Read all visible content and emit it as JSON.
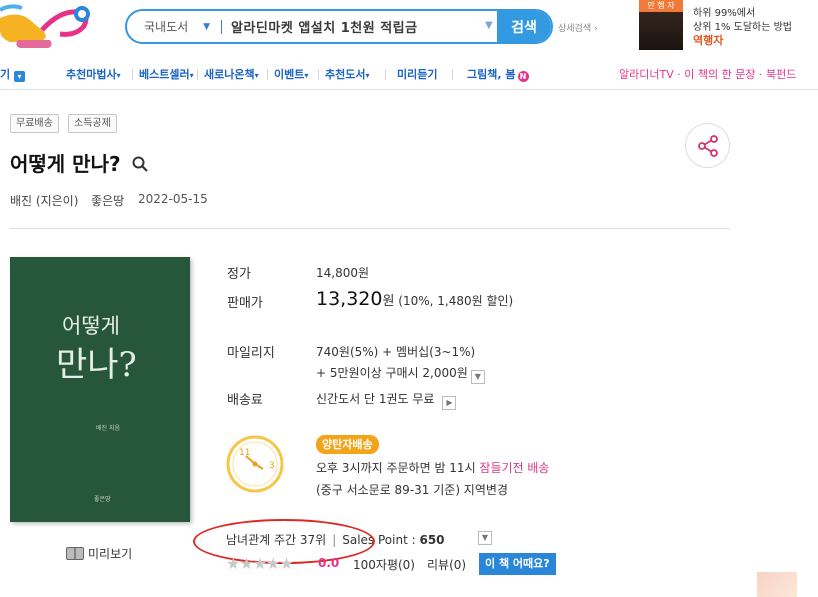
{
  "header": {
    "search": {
      "category": "국내도서",
      "query": "알라딘마켓 앱설치 1천원 적립금",
      "button": "검색",
      "detail_link": "상세검색"
    },
    "ad": {
      "book_tag": "만 행 자",
      "line1": "하위 99%에서",
      "line2": "상위 1% 도달하는 방법",
      "line3": "역행자"
    }
  },
  "nav": {
    "items": [
      {
        "label": "기",
        "has_icon": true
      },
      {
        "label": "추천마법사"
      },
      {
        "label": "베스트셀러"
      },
      {
        "label": "새로나온책"
      },
      {
        "label": "이벤트"
      },
      {
        "label": "추천도서"
      },
      {
        "label": "미리듣기"
      },
      {
        "label": "그림책, 봄"
      }
    ],
    "right": {
      "item1": "알라디너TV",
      "item2": "이 책의 한 문장",
      "item3": "북펀드"
    },
    "badge_n": "N"
  },
  "product": {
    "badges": [
      "무료배송",
      "소득공제"
    ],
    "title": "어떻게 만나?",
    "author": "배진 (지은이)",
    "publisher": "좋은땅",
    "pub_date": "2022-05-15",
    "cover": {
      "title_line1": "어떻게",
      "title_line2": "만나?",
      "author_small": "배진 지음",
      "publisher_small": "좋은땅"
    },
    "preview_label": "미리보기",
    "price": {
      "list_label": "정가",
      "list_value": "14,800원",
      "sale_label": "판매가",
      "sale_number": "13,320",
      "sale_unit": "원",
      "sale_detail": "(10%, 1,480원 할인)"
    },
    "mileage": {
      "label": "마일리지",
      "line1": "740원(5%) + 멤버십(3~1%)",
      "line2": "+ 5만원이상 구매시 2,000원"
    },
    "shipping": {
      "label": "배송료",
      "value": "신간도서 단 1권도 무료"
    },
    "delivery": {
      "clock_left": "11",
      "clock_right": "3",
      "badge": "양탄자배송",
      "line1_prefix": "오후 3시까지 주문하면 밤 11시 ",
      "line1_highlight": "잠들기전 배송",
      "line2": "(중구 서소문로 89-31 기준) 지역변경"
    },
    "rank": {
      "text": "남녀관계 주간 37위",
      "sales_point_label": "Sales Point :",
      "sales_point_value": "650"
    },
    "rating": {
      "stars": "★★★★★",
      "score": "0.0",
      "reviews100": "100자평(0)",
      "reviews": "리뷰(0)",
      "how_button": "이 책 어때요?"
    }
  },
  "colors": {
    "accent_blue": "#3399e0",
    "nav_blue": "#1b63c6",
    "pink": "#e6338a",
    "highlight_red": "#d92a24",
    "cover_green": "#26573a",
    "delivery_orange": "#f3a51a"
  }
}
